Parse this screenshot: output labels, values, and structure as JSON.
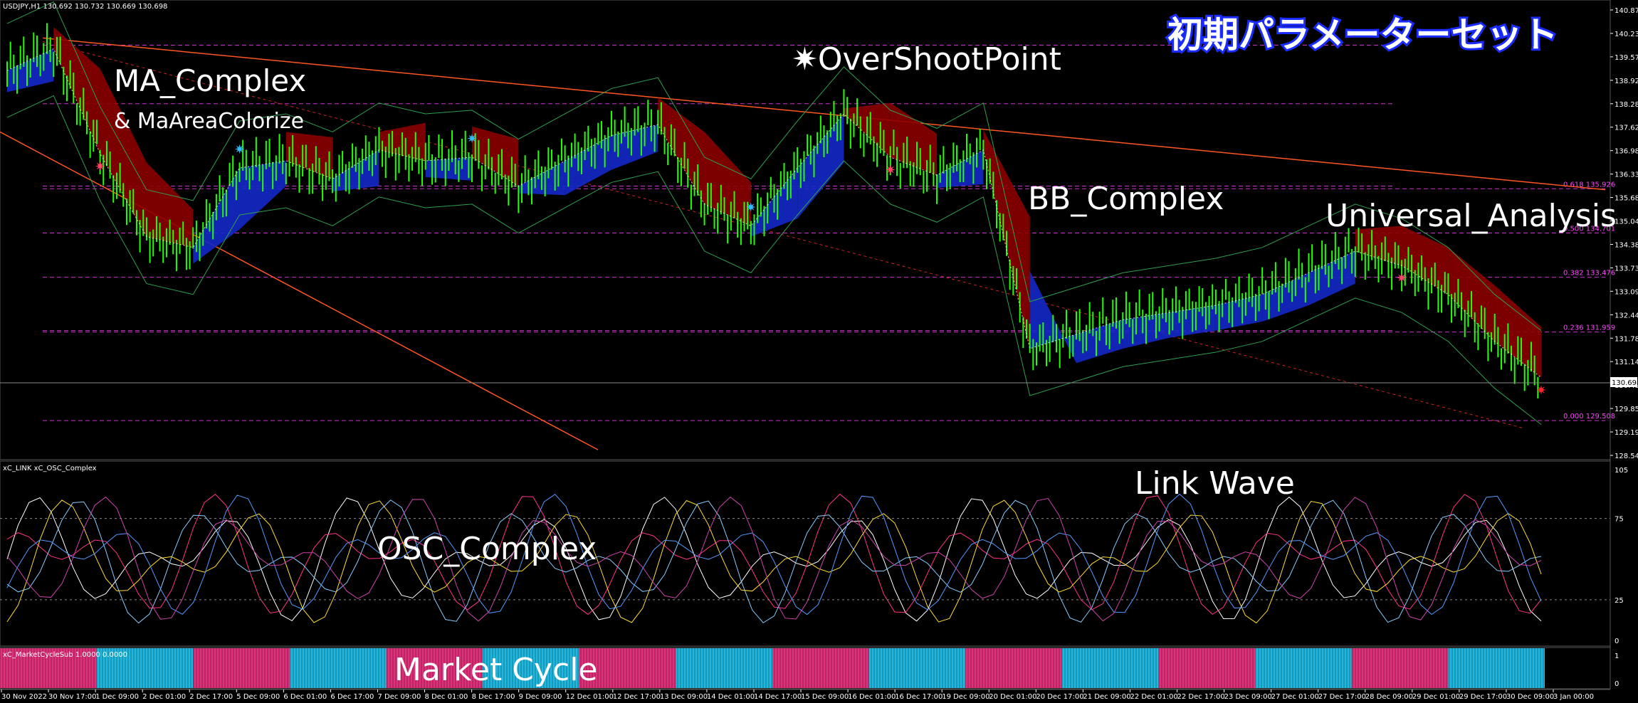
{
  "window": {
    "symbol_bar": "USDJPY,H1  130.692 130.732 130.669 130.698"
  },
  "overlay_labels": {
    "title_jp": "初期パラメーターセット",
    "ma_complex": "MA_Complex",
    "ma_area": "& MaAreaColorize",
    "overshoot": "✷OverShootPoint",
    "bb_complex": "BB_Complex",
    "universal": "Universal_Analysis",
    "link_wave": "Link Wave",
    "osc_complex": "OSC_Complex",
    "market_cycle": "Market Cycle"
  },
  "sub1": {
    "caption": "xC_LINK  xC_OSC_Complex"
  },
  "sub2": {
    "caption": "xC_MarketCycleSub 1.0000 0.0000"
  },
  "price_axis": {
    "ticks": [
      "140.875",
      "140.230",
      "139.570",
      "138.925",
      "138.280",
      "137.625",
      "136.980",
      "136.335",
      "135.685",
      "135.040",
      "134.380",
      "133.735",
      "133.090",
      "132.445",
      "131.785",
      "131.140",
      "130.495",
      "129.850",
      "129.190",
      "128.545"
    ],
    "current_price": "130.698"
  },
  "osc_axis": {
    "ticks": [
      "105",
      "75",
      "25",
      "0"
    ]
  },
  "cycle_axis": {
    "ticks": [
      "1",
      "0"
    ]
  },
  "time_axis": {
    "ticks": [
      "30 Nov 2022",
      "30 Nov 17:00",
      "1 Dec 09:00",
      "2 Dec 01:00",
      "2 Dec 17:00",
      "5 Dec 09:00",
      "6 Dec 01:00",
      "6 Dec 17:00",
      "7 Dec 09:00",
      "8 Dec 01:00",
      "8 Dec 17:00",
      "9 Dec 09:00",
      "12 Dec 01:00",
      "12 Dec 17:00",
      "13 Dec 09:00",
      "14 Dec 01:00",
      "14 Dec 17:00",
      "15 Dec 09:00",
      "16 Dec 01:00",
      "16 Dec 17:00",
      "19 Dec 09:00",
      "20 Dec 01:00",
      "20 Dec 17:00",
      "21 Dec 09:00",
      "22 Dec 01:00",
      "22 Dec 17:00",
      "23 Dec 09:00",
      "27 Dec 01:00",
      "27 Dec 17:00",
      "28 Dec 09:00",
      "29 Dec 01:00",
      "29 Dec 17:00",
      "30 Dec 09:00",
      "3 Jan 00:00"
    ]
  },
  "fib_levels": [
    {
      "label": "0.618 135.926",
      "price": 135.926
    },
    {
      "label": "0.500 134.701",
      "price": 134.701
    },
    {
      "label": "0.382 133.476",
      "price": 133.476
    },
    {
      "label": "0.236 131.959",
      "price": 131.959
    },
    {
      "label": "0.000 129.508",
      "price": 129.508
    }
  ],
  "colors": {
    "background": "#000000",
    "candle": "#22ff00",
    "ma_down_area": "#8b0000",
    "ma_up_area": "#1428c8",
    "fib_line": "#cc33cc",
    "trend_line": "#ff5522",
    "cycle_pink": "#e0307a",
    "cycle_blue": "#20b8e0",
    "title_stroke": "#1a2bff"
  },
  "chart_data": {
    "type": "line",
    "title": "USDJPY,H1",
    "price_series": [
      {
        "x": "30 Nov 2022",
        "y": 139.2
      },
      {
        "x": "30 Nov 17:00",
        "y": 139.8
      },
      {
        "x": "1 Dec 09:00",
        "y": 136.9
      },
      {
        "x": "2 Dec 01:00",
        "y": 134.6
      },
      {
        "x": "2 Dec 17:00",
        "y": 134.3
      },
      {
        "x": "5 Dec 09:00",
        "y": 136.5
      },
      {
        "x": "6 Dec 01:00",
        "y": 136.7
      },
      {
        "x": "6 Dec 17:00",
        "y": 136.2
      },
      {
        "x": "7 Dec 09:00",
        "y": 137.0
      },
      {
        "x": "8 Dec 01:00",
        "y": 136.7
      },
      {
        "x": "8 Dec 17:00",
        "y": 136.8
      },
      {
        "x": "9 Dec 09:00",
        "y": 136.0
      },
      {
        "x": "12 Dec 01:00",
        "y": 136.7
      },
      {
        "x": "12 Dec 17:00",
        "y": 137.4
      },
      {
        "x": "13 Dec 09:00",
        "y": 137.7
      },
      {
        "x": "14 Dec 01:00",
        "y": 135.5
      },
      {
        "x": "14 Dec 17:00",
        "y": 134.9
      },
      {
        "x": "15 Dec 09:00",
        "y": 136.5
      },
      {
        "x": "16 Dec 01:00",
        "y": 138.0
      },
      {
        "x": "16 Dec 17:00",
        "y": 136.8
      },
      {
        "x": "19 Dec 09:00",
        "y": 136.3
      },
      {
        "x": "20 Dec 01:00",
        "y": 137.0
      },
      {
        "x": "20 Dec 17:00",
        "y": 131.5
      },
      {
        "x": "21 Dec 09:00",
        "y": 131.9
      },
      {
        "x": "22 Dec 01:00",
        "y": 132.3
      },
      {
        "x": "22 Dec 17:00",
        "y": 132.5
      },
      {
        "x": "23 Dec 09:00",
        "y": 132.7
      },
      {
        "x": "27 Dec 01:00",
        "y": 133.0
      },
      {
        "x": "27 Dec 17:00",
        "y": 133.6
      },
      {
        "x": "28 Dec 09:00",
        "y": 134.2
      },
      {
        "x": "29 Dec 01:00",
        "y": 133.8
      },
      {
        "x": "29 Dec 17:00",
        "y": 133.0
      },
      {
        "x": "30 Dec 09:00",
        "y": 131.7
      },
      {
        "x": "3 Jan 00:00",
        "y": 130.7
      }
    ],
    "ylim": [
      128.545,
      140.875
    ],
    "osc_ylim": [
      0,
      105
    ],
    "osc_levels": [
      75,
      25
    ],
    "market_cycle": [
      "pink",
      "blue",
      "pink",
      "blue",
      "pink",
      "blue",
      "pink",
      "blue",
      "pink",
      "blue",
      "pink",
      "blue",
      "pink",
      "blue",
      "pink",
      "blue"
    ]
  }
}
